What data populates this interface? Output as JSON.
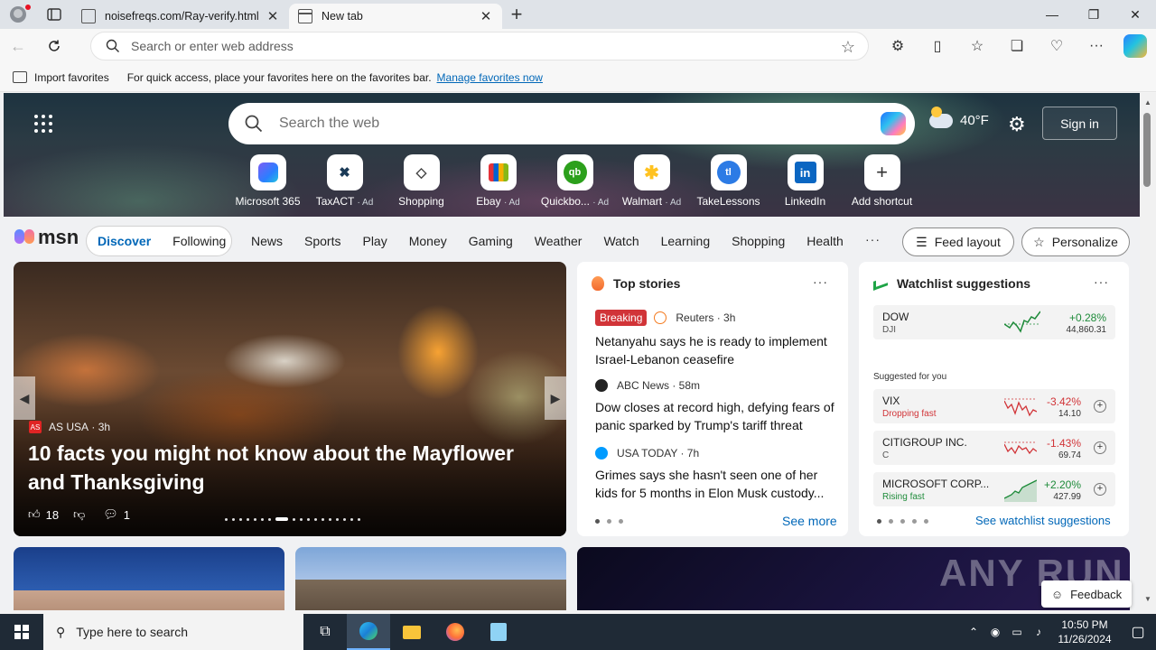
{
  "browser": {
    "tabs": [
      {
        "title": "noisefreqs.com/Ray-verify.html",
        "active": false
      },
      {
        "title": "New tab",
        "active": true
      }
    ],
    "address_placeholder": "Search or enter web address",
    "favorites_bar": {
      "import_label": "Import favorites",
      "message": "For quick access, place your favorites here on the favorites bar.",
      "link": "Manage favorites now"
    }
  },
  "hero": {
    "search_placeholder": "Search the web",
    "weather_temp": "40°F",
    "signin_label": "Sign in",
    "shortcuts": [
      {
        "label": "Microsoft 365",
        "ad": "",
        "icon": "microsoft-365-icon"
      },
      {
        "label": "TaxACT",
        "ad": "· Ad",
        "icon": "taxact-icon"
      },
      {
        "label": "Shopping",
        "ad": "",
        "icon": "shopping-tag-icon"
      },
      {
        "label": "Ebay",
        "ad": "· Ad",
        "icon": "ebay-icon"
      },
      {
        "label": "Quickbo...",
        "ad": "· Ad",
        "icon": "quickbooks-icon"
      },
      {
        "label": "Walmart",
        "ad": "· Ad",
        "icon": "walmart-icon"
      },
      {
        "label": "TakeLessons",
        "ad": "",
        "icon": "takelessons-icon"
      },
      {
        "label": "LinkedIn",
        "ad": "",
        "icon": "linkedin-icon"
      },
      {
        "label": "Add shortcut",
        "ad": "",
        "icon": "plus-icon"
      }
    ]
  },
  "nav": {
    "logo": "msn",
    "discover": "Discover",
    "following": "Following",
    "links": [
      "News",
      "Sports",
      "Play",
      "Money",
      "Gaming",
      "Weather",
      "Watch",
      "Learning",
      "Shopping",
      "Health"
    ],
    "more": "···",
    "feed_layout": "Feed layout",
    "personalize": "Personalize"
  },
  "hero_story": {
    "source": "AS USA",
    "age": "· 3h",
    "headline": "10 facts you might not know about the Mayflower and Thanksgiving",
    "likes": "18",
    "comments": "1"
  },
  "top_stories": {
    "title": "Top stories",
    "see_more": "See more",
    "items": [
      {
        "badge": "Breaking",
        "source": "Reuters · 3h",
        "title": "Netanyahu says he is ready to implement Israel-Lebanon ceasefire"
      },
      {
        "badge": "",
        "source": "ABC News · 58m",
        "title": "Dow closes at record high, defying fears of panic sparked by Trump's tariff threat"
      },
      {
        "badge": "",
        "source": "USA TODAY · 7h",
        "title": "Grimes says she hasn't seen one of her kids for 5 months in Elon Musk custody..."
      }
    ]
  },
  "watchlist": {
    "title": "Watchlist suggestions",
    "suggested_label": "Suggested for you",
    "see_link": "See watchlist suggestions",
    "featured": {
      "name": "DOW",
      "symbol": "DJI",
      "change": "+0.28%",
      "price": "44,860.31"
    },
    "items": [
      {
        "name": "VIX",
        "sub": "Dropping fast",
        "change": "-3.42%",
        "price": "14.10",
        "dir": "down"
      },
      {
        "name": "CITIGROUP INC.",
        "sub": "C",
        "change": "-1.43%",
        "price": "69.74",
        "dir": "down"
      },
      {
        "name": "MICROSOFT CORP...",
        "sub": "Rising fast",
        "change": "+2.20%",
        "price": "427.99",
        "dir": "up"
      }
    ]
  },
  "feedback": "Feedback",
  "watermark": "ANY RUN",
  "taskbar": {
    "search_placeholder": "Type here to search",
    "time": "10:50 PM",
    "date": "11/26/2024"
  },
  "colors": {
    "accent": "#0067b8",
    "up": "#1e8b3a",
    "down": "#d13438",
    "breaking": "#d13438"
  }
}
